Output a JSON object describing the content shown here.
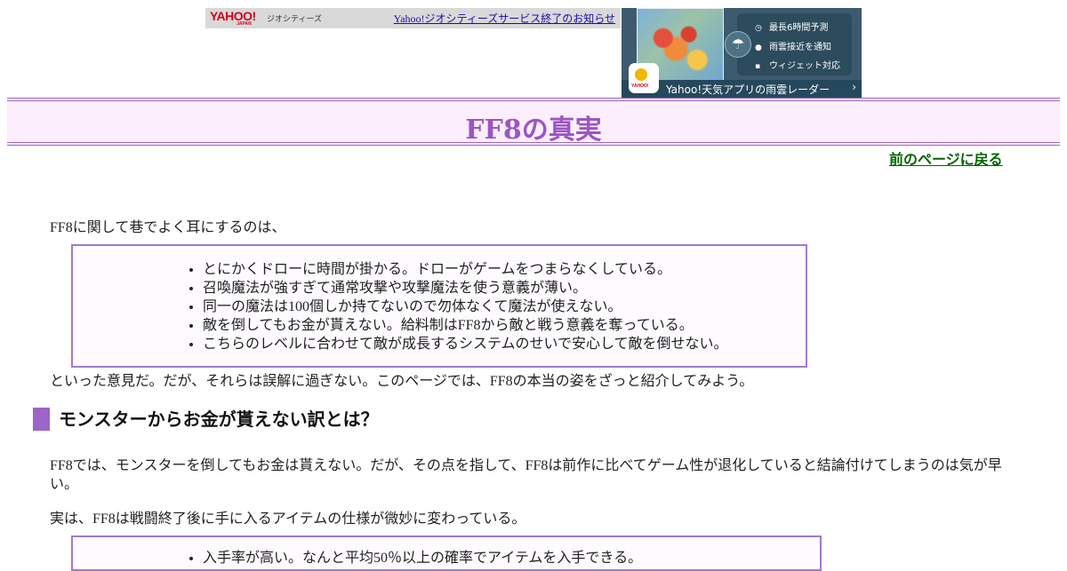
{
  "header_banner": {
    "logo": "YAHOO!",
    "logo_sub": "JAPAN",
    "service_name": "ジオシティーズ",
    "notice_link": "Yahoo!ジオシティーズサービス終了のお知らせ"
  },
  "ad": {
    "features": [
      "最長6時間予測",
      "雨雲接近を通知",
      "ウィジェット対応"
    ],
    "feature_icons": [
      "clock-icon",
      "pin-icon",
      "widget-icon"
    ],
    "bottom_text": "Yahoo!天気アプリの雨雲レーダー",
    "app_tag": "YAHOO!"
  },
  "page": {
    "title": "FF8の真実",
    "back_link": "前のページに戻る",
    "intro": "FF8に関して巷でよく耳にするのは、",
    "complaints": [
      "とにかくドローに時間が掛かる。ドローがゲームをつまらなくしている。",
      "召喚魔法が強すぎて通常攻撃や攻撃魔法を使う意義が薄い。",
      "同一の魔法は100個しか持てないので勿体なくて魔法が使えない。",
      "敵を倒してもお金が貰えない。給料制はFF8から敵と戦う意義を奪っている。",
      "こちらのレベルに合わせて敵が成長するシステムのせいで安心して敵を倒せない。"
    ],
    "after_list": "といった意見だ。だが、それらは誤解に過ぎない。このページでは、FF8の本当の姿をざっと紹介してみよう。",
    "section1_heading": "モンスターからお金が貰えない訳とは？",
    "section1_para1": "FF8では、モンスターを倒してもお金は貰えない。だが、その点を指して、FF8は前作に比べてゲーム性が退化していると結論付けてしまうのは気が早い。",
    "section1_para2": "実は、FF8は戦闘終了後に手に入るアイテムの仕様が微妙に変わっている。",
    "items_list": [
      "入手率が高い。なんと平均50％以上の確率でアイテムを入手できる。"
    ]
  },
  "colors": {
    "accent": "#9b66c8",
    "title_band_bg": "#fdeefd",
    "title_text": "#9b55c4",
    "back_link": "#006400",
    "link": "#1a0dab"
  }
}
